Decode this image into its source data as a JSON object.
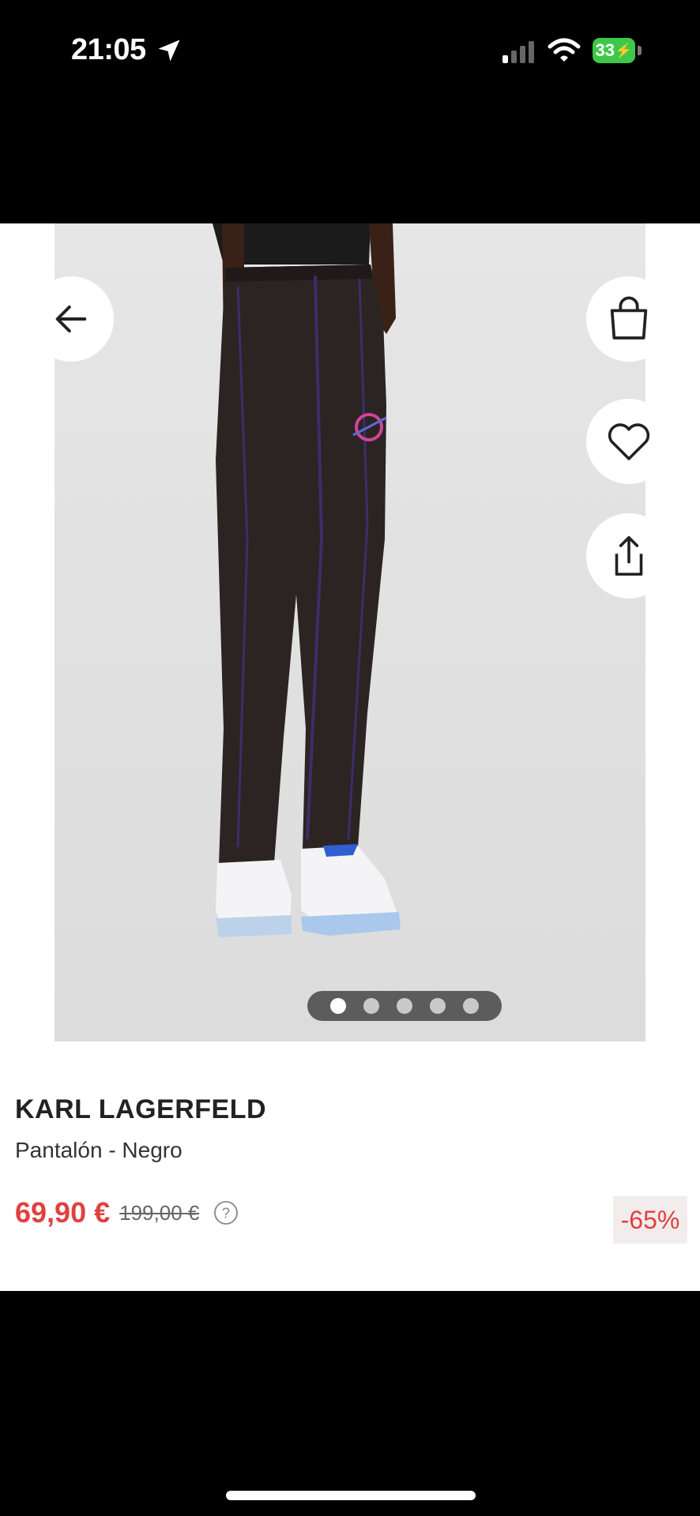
{
  "status_bar": {
    "time": "21:05",
    "battery": "33"
  },
  "gallery": {
    "slide_count": 5,
    "active_slide": 1
  },
  "product": {
    "brand": "KARL LAGERFELD",
    "name": "Pantalón - Negro",
    "price": "69,90 €",
    "old_price": "199,00 €",
    "discount": "-65%"
  },
  "colors": {
    "sale": "#e0403f",
    "battery": "#3ec84a"
  },
  "icons": [
    "location-arrow-icon",
    "signal-icon",
    "wifi-icon",
    "battery-icon",
    "back-arrow-icon",
    "shopping-bag-icon",
    "heart-icon",
    "share-icon",
    "help-icon"
  ]
}
